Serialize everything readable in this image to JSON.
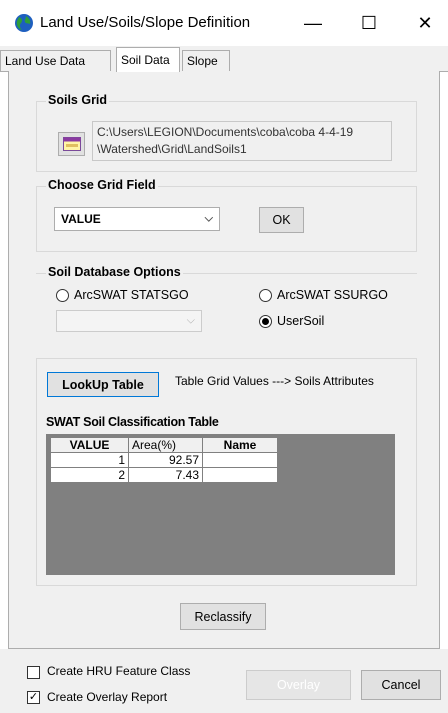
{
  "window": {
    "title": "Land Use/Soils/Slope Definition",
    "minimize_glyph": "—",
    "maximize_glyph": "☐",
    "close_glyph": "✕"
  },
  "tabs": [
    {
      "label": "Land Use Data",
      "active": false
    },
    {
      "label": "Soil Data",
      "active": true
    },
    {
      "label": "Slope",
      "active": false
    }
  ],
  "soils_grid": {
    "group_title": "Soils Grid",
    "path_line1": "C:\\Users\\LEGION\\Documents\\coba\\coba 4-4-19",
    "path_line2": "\\Watershed\\Grid\\LandSoils1"
  },
  "choose_grid_field": {
    "group_title": "Choose Grid Field",
    "selected": "VALUE",
    "ok_label": "OK"
  },
  "soil_db": {
    "group_title": "Soil Database Options",
    "options": [
      {
        "label": "ArcSWAT STATSGO",
        "selected": false
      },
      {
        "label": "ArcSWAT SSURGO",
        "selected": false
      },
      {
        "label": "UserSoil",
        "selected": true
      }
    ],
    "dropdown_value": ""
  },
  "lookup": {
    "button_label": "LookUp Table",
    "description": "Table Grid Values ---> Soils Attributes"
  },
  "classification": {
    "title": "SWAT Soil Classification Table",
    "headers": [
      "VALUE",
      "Area(%)",
      "Name"
    ],
    "rows": [
      {
        "value": "1",
        "area": "92.57",
        "name": ""
      },
      {
        "value": "2",
        "area": "7.43",
        "name": ""
      }
    ]
  },
  "reclassify_label": "Reclassify",
  "bottom": {
    "create_hru_label": "Create HRU Feature Class",
    "create_hru_checked": false,
    "create_overlay_label": "Create Overlay Report",
    "create_overlay_checked": true,
    "overlay_label": "Overlay",
    "cancel_label": "Cancel"
  },
  "colors": {
    "globe_blue": "#1e5fbf",
    "globe_green": "#2e9e3a",
    "lookup_border": "#0078d7",
    "grid_background": "#808080"
  }
}
